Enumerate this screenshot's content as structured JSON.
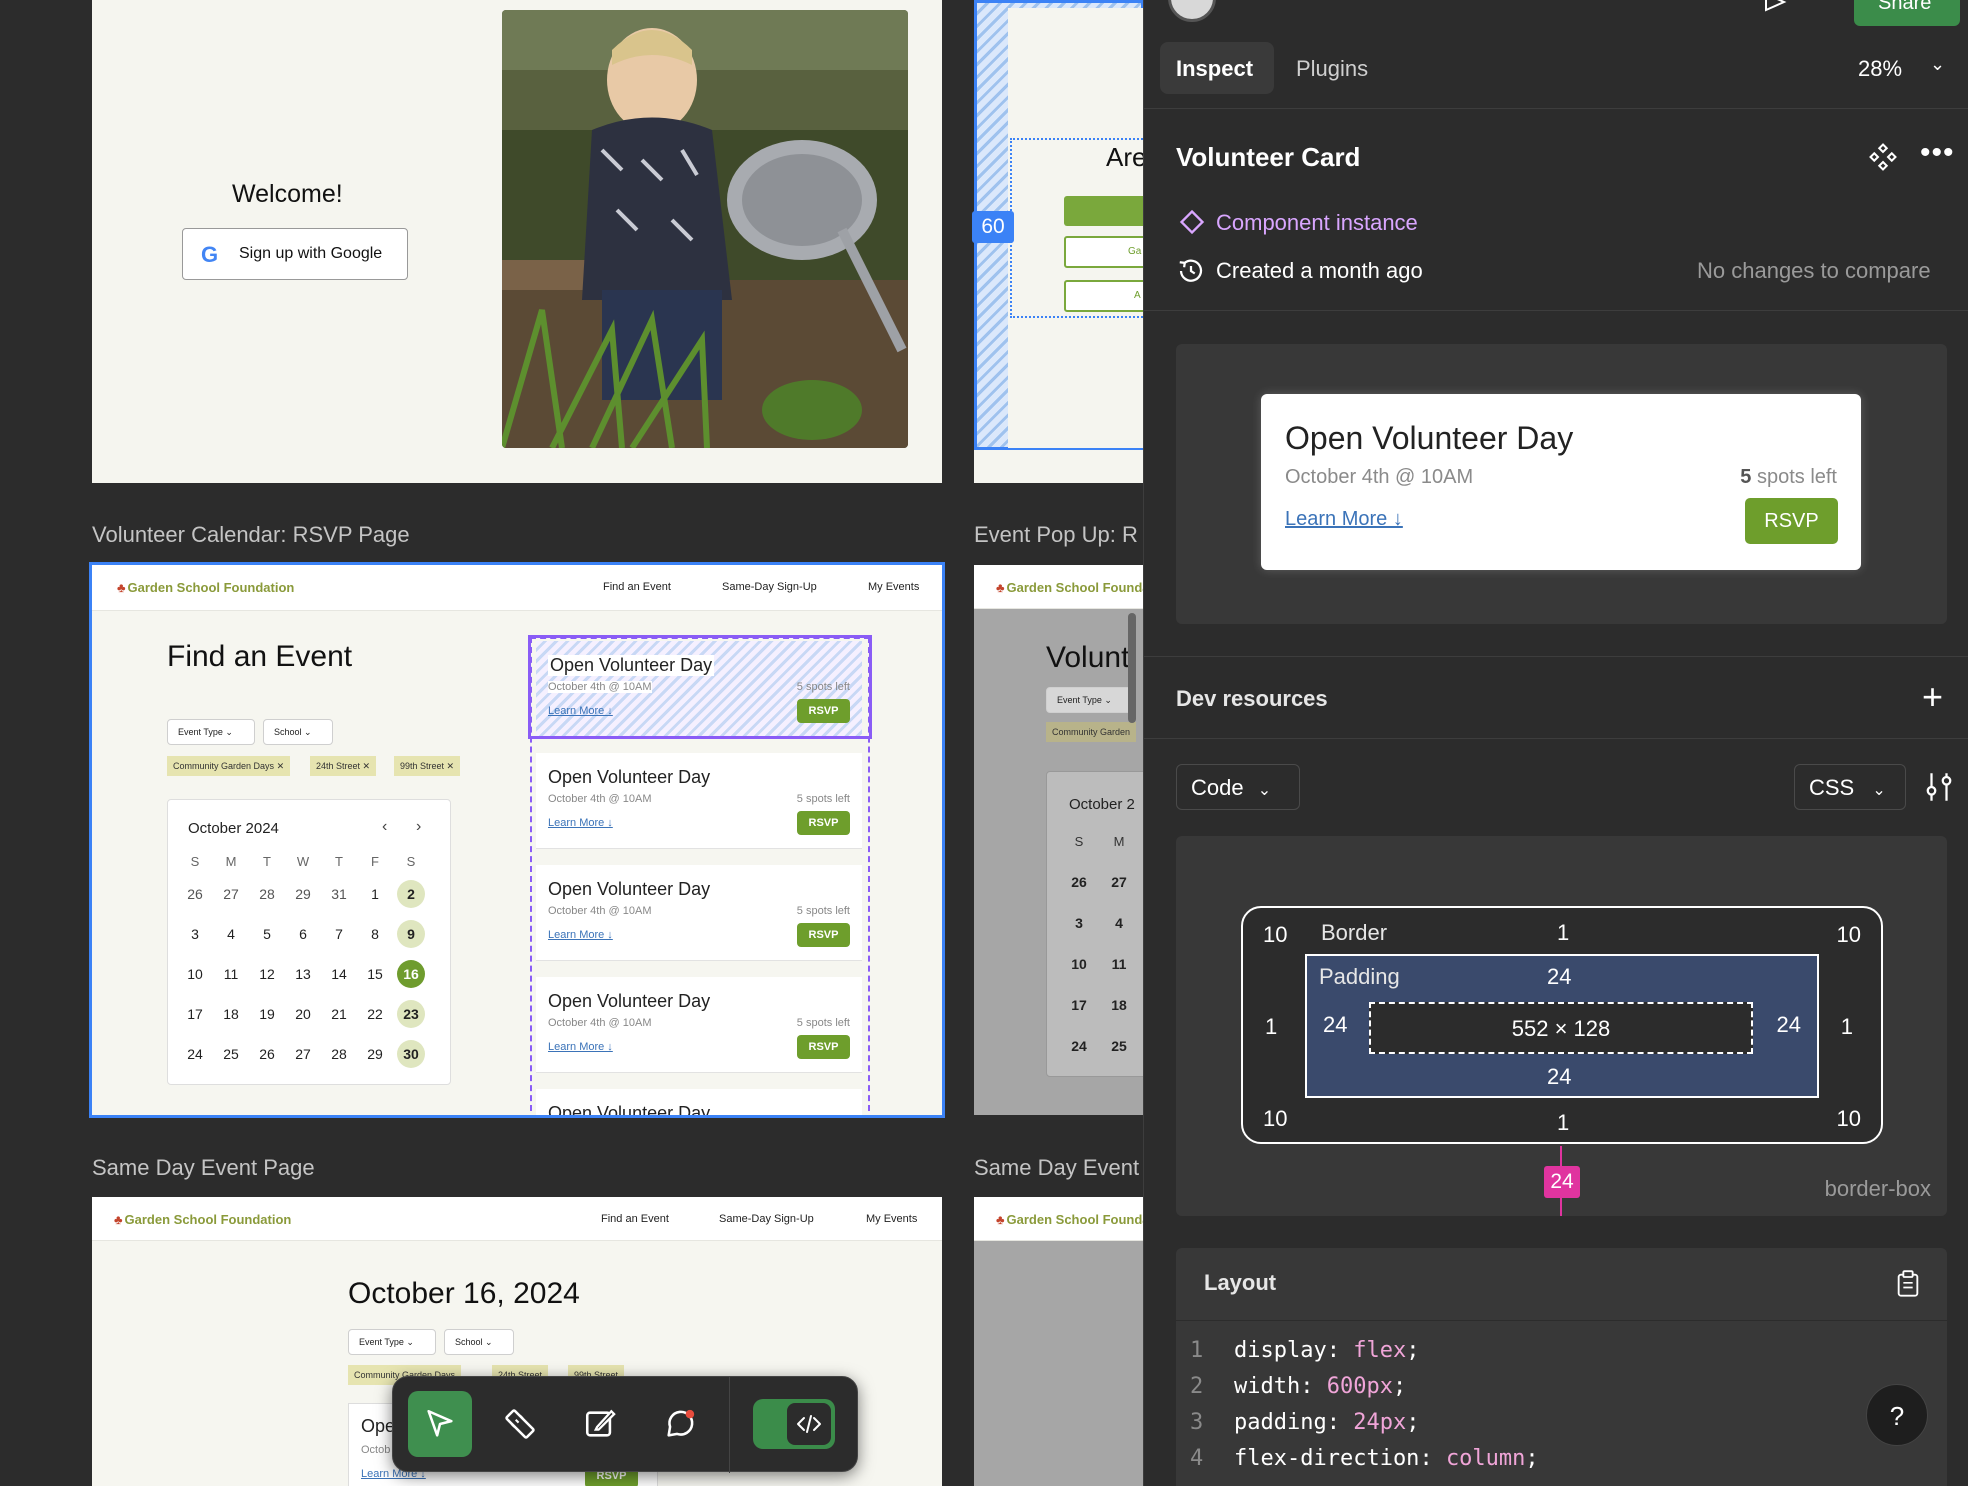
{
  "canvas": {
    "welcome_frame": {
      "title": "Welcome!",
      "google_button": "Sign up with Google"
    },
    "frame_labels": {
      "rsvp": "Volunteer Calendar: RSVP Page",
      "popup": "Event Pop Up: R",
      "same_day": "Same Day Event Page",
      "same_day_2": "Same Day Event"
    },
    "partial_frame": {
      "heading": "Are",
      "button_1": "Ga",
      "button_2": "A"
    },
    "measure_badge": "60",
    "site": {
      "logo": "Garden School Foundation",
      "nav": [
        "Find an Event",
        "Same-Day Sign-Up",
        "My Events"
      ]
    },
    "rsvp_page": {
      "heading": "Find an Event",
      "filters": [
        "Event Type",
        "School"
      ],
      "chips": [
        "Community Garden Days",
        "24th Street",
        "99th Street"
      ],
      "calendar": {
        "month": "October 2024",
        "day_headers": [
          "S",
          "M",
          "T",
          "W",
          "T",
          "F",
          "S"
        ],
        "weeks": [
          [
            "26",
            "27",
            "28",
            "29",
            "31",
            "1",
            "2"
          ],
          [
            "3",
            "4",
            "5",
            "6",
            "7",
            "8",
            "9"
          ],
          [
            "10",
            "11",
            "12",
            "13",
            "14",
            "15",
            "16"
          ],
          [
            "17",
            "18",
            "19",
            "20",
            "21",
            "22",
            "23"
          ],
          [
            "24",
            "25",
            "26",
            "27",
            "28",
            "29",
            "30"
          ]
        ],
        "highlighted": [
          "2",
          "9",
          "23",
          "30"
        ],
        "selected": "16"
      },
      "events": [
        {
          "title": "Open Volunteer Day",
          "date": "October 4th @ 10AM",
          "spots": "5 spots left",
          "link": "Learn More ↓",
          "button": "RSVP"
        },
        {
          "title": "Open Volunteer Day",
          "date": "October 4th @ 10AM",
          "spots": "5 spots left",
          "link": "Learn More ↓",
          "button": "RSVP"
        },
        {
          "title": "Open Volunteer Day",
          "date": "October 4th @ 10AM",
          "spots": "5 spots left",
          "link": "Learn More ↓",
          "button": "RSVP"
        },
        {
          "title": "Open Volunteer Day",
          "date": "October 4th @ 10AM",
          "spots": "5 spots left",
          "link": "Learn More ↓",
          "button": "RSVP"
        },
        {
          "title": "Open Volunteer Day",
          "date": "",
          "spots": "",
          "link": "",
          "button": ""
        }
      ]
    },
    "popup_page": {
      "heading": "Volunt",
      "filter": "Event Type",
      "chip": "Community Garden",
      "calendar_month": "October 2",
      "day_headers": [
        "S",
        "M"
      ],
      "rows": [
        [
          "26",
          "27"
        ],
        [
          "3",
          "4"
        ],
        [
          "10",
          "11"
        ],
        [
          "17",
          "18"
        ],
        [
          "24",
          "25"
        ]
      ]
    },
    "same_day_page": {
      "heading": "October 16, 2024",
      "filters": [
        "Event Type",
        "School"
      ],
      "chips": [
        "Community Garden Days",
        "24th Street",
        "99th Street"
      ],
      "event_title": "Ope",
      "event_date": "Octob",
      "event_link": "Learn More ↓",
      "event_button": "RSVP"
    }
  },
  "panel": {
    "tabs": [
      "Inspect",
      "Plugins"
    ],
    "zoom": "28%",
    "share": "Share",
    "component_name": "Volunteer Card",
    "component_instance": "Component instance",
    "created": "Created a month ago",
    "no_changes": "No changes to compare",
    "preview_card": {
      "title": "Open Volunteer Day",
      "date": "October 4th @ 10AM",
      "spots_count": "5",
      "spots_label": "spots left",
      "link": "Learn More ↓",
      "button": "RSVP"
    },
    "dev_resources": "Dev resources",
    "code_select": "Code",
    "lang_select": "CSS",
    "box_model": {
      "border_label": "Border",
      "padding_label": "Padding",
      "radius_tl": "10",
      "radius_tr": "10",
      "radius_bl": "10",
      "radius_br": "10",
      "border_top": "1",
      "border_bottom": "1",
      "border_left": "1",
      "border_right": "1",
      "padding_top": "24",
      "padding_bottom": "24",
      "padding_left": "24",
      "padding_right": "24",
      "content_size": "552 × 128",
      "gap": "24",
      "box_sizing": "border-box"
    },
    "layout_title": "Layout",
    "code_lines": [
      {
        "num": "1",
        "prop": "display",
        "value": "flex"
      },
      {
        "num": "2",
        "prop": "width",
        "value": "600px"
      },
      {
        "num": "3",
        "prop": "padding",
        "value": "24px"
      },
      {
        "num": "4",
        "prop": "flex-direction",
        "value": "column"
      }
    ],
    "help": "?"
  },
  "colors": {
    "canvas_bg": "#2c2c2c",
    "panel_bg": "#2c2c2c",
    "accent_green": "#6e9e2c",
    "figma_green": "#3b8c4a",
    "selection_blue": "#3b82f6",
    "component_purple": "#d9a6ff",
    "code_value_pink": "#f0a5d8",
    "gap_badge_pink": "#e0349f",
    "padding_box": "#3a4a6c"
  }
}
